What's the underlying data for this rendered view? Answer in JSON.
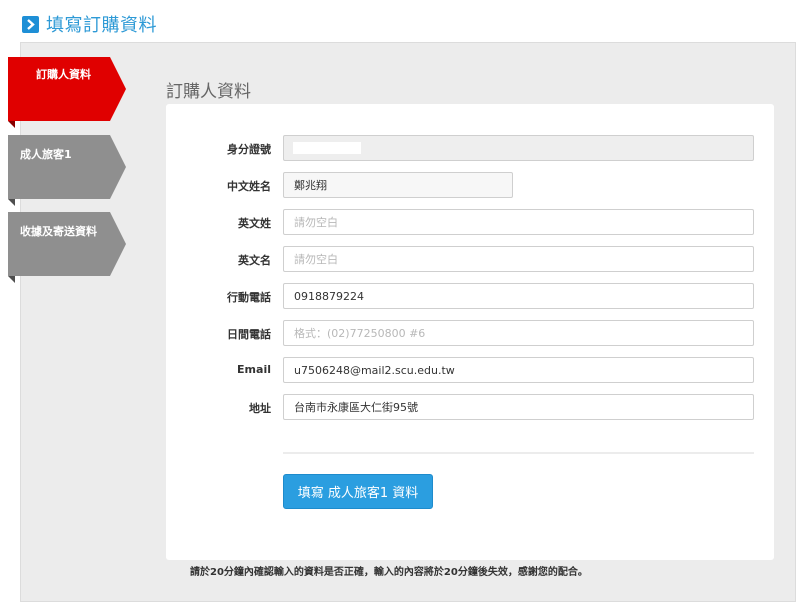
{
  "header": {
    "title": "填寫訂購資料"
  },
  "steps": [
    {
      "label": "訂購人資料",
      "active": true
    },
    {
      "label": "成人旅客1",
      "active": false
    },
    {
      "label": "收據及寄送資料",
      "active": false
    }
  ],
  "section": {
    "title": "訂購人資料"
  },
  "form": {
    "id_number": {
      "label": "身分證號",
      "value": ""
    },
    "chinese_name": {
      "label": "中文姓名",
      "value": "鄭兆翔"
    },
    "english_surname": {
      "label": "英文姓",
      "placeholder": "請勿空白",
      "value": ""
    },
    "english_given_name": {
      "label": "英文名",
      "placeholder": "請勿空白",
      "value": ""
    },
    "mobile": {
      "label": "行動電話",
      "value": "0918879224"
    },
    "day_phone": {
      "label": "日間電話",
      "placeholder": "格式：(02)77250800 #6",
      "value": ""
    },
    "email": {
      "label": "Email",
      "value": "u7506248@mail2.scu.edu.tw"
    },
    "address": {
      "label": "地址",
      "value": "台南市永康區大仁街95號"
    }
  },
  "submit_label": "填寫 成人旅客1 資料",
  "notice": "請於20分鐘內確認輸入的資料是否正確，輸入的內容將於20分鐘後失效，感謝您的配合。",
  "colors": {
    "accent": "#2b9ee0",
    "active_step": "#e00000",
    "inactive_step": "#8f8f8f"
  }
}
